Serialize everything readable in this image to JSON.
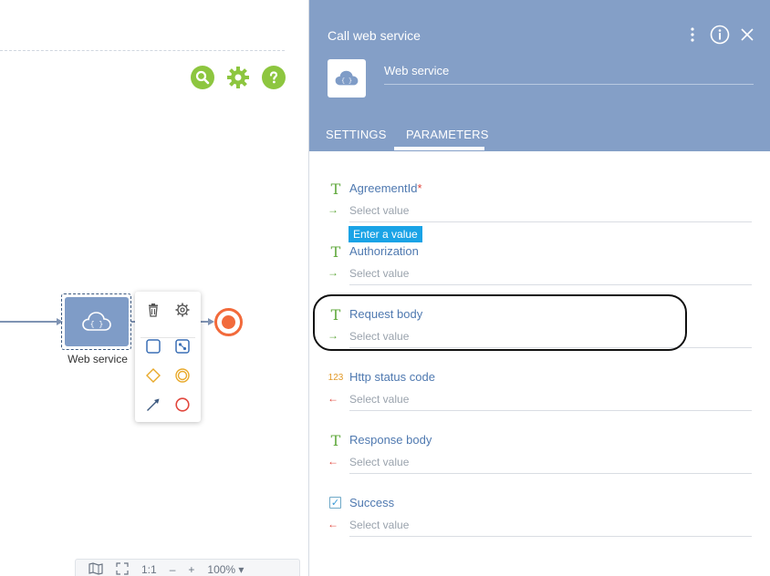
{
  "canvas": {
    "node": {
      "label": "Web service"
    },
    "zoom_bar": {
      "fit_label": "1:1",
      "minus_label": "–",
      "plus_label": "+",
      "zoom_value": "100%"
    }
  },
  "panel": {
    "title": "Call web service",
    "element_name": "Web service",
    "tabs": [
      {
        "label": "SETTINGS",
        "active": false
      },
      {
        "label": "PARAMETERS",
        "active": true
      }
    ],
    "tooltip": "Enter a value",
    "parameters": [
      {
        "type": "T",
        "name": "AgreementId",
        "required": "*",
        "direction": "→",
        "dir_class": "in",
        "value": "Select value"
      },
      {
        "type": "T",
        "name": "Authorization",
        "required": "",
        "direction": "→",
        "dir_class": "in",
        "value": "Select value"
      },
      {
        "type": "T",
        "name": "Request body",
        "required": "",
        "direction": "→",
        "dir_class": "in",
        "value": "Select value"
      },
      {
        "type": "123",
        "name": "Http status code",
        "required": "",
        "direction": "←",
        "dir_class": "out",
        "value": "Select value"
      },
      {
        "type": "T",
        "name": "Response body",
        "required": "",
        "direction": "←",
        "dir_class": "out",
        "value": "Select value"
      },
      {
        "type": "checkbox",
        "name": "Success",
        "required": "",
        "direction": "←",
        "dir_class": "out",
        "value": "Select value"
      }
    ]
  },
  "colors": {
    "header_bg": "#849fc7",
    "accent_green": "#8dc63f",
    "end_event": "#f26a3b",
    "tooltip_bg": "#1aa3e6",
    "param_name": "#4f79b0"
  }
}
